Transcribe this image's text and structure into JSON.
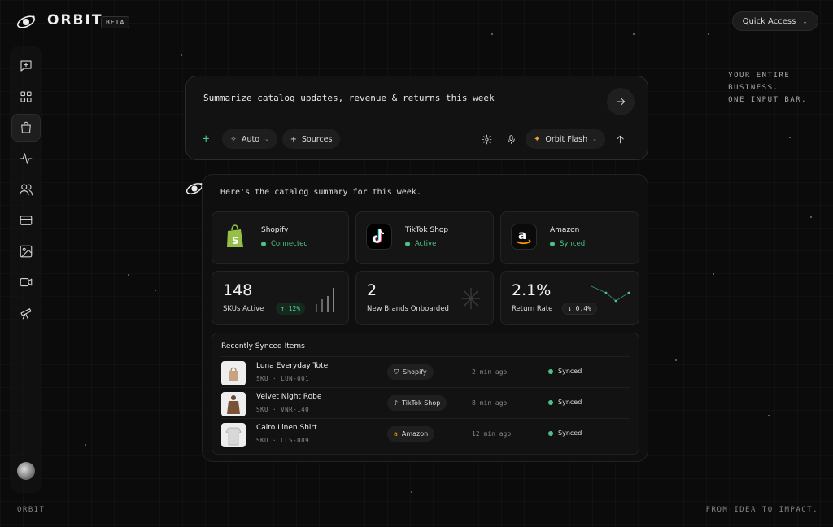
{
  "app": {
    "name": "ORBIT",
    "badge": "BETA",
    "quick_access": "Quick Access"
  },
  "tagline": [
    "YOUR ENTIRE",
    "BUSINESS.",
    "ONE INPUT BAR."
  ],
  "footer": {
    "left": "ORBIT",
    "right": "FROM IDEA TO IMPACT."
  },
  "sidebar": {
    "items": [
      {
        "icon": "new-chat-icon"
      },
      {
        "icon": "grid-icon"
      },
      {
        "icon": "shopping-bag-icon",
        "active": true
      },
      {
        "icon": "activity-icon"
      },
      {
        "icon": "users-icon"
      },
      {
        "icon": "credit-card-icon"
      },
      {
        "icon": "image-icon"
      },
      {
        "icon": "video-icon"
      },
      {
        "icon": "telescope-icon"
      }
    ]
  },
  "prompt": {
    "text": "Summarize catalog updates, revenue & returns this week",
    "mode": "Auto",
    "sources": "Sources",
    "model": "Orbit Flash"
  },
  "response": {
    "intro": "Here's the catalog summary for this week.",
    "stores": [
      {
        "name": "Shopify",
        "status": "Connected"
      },
      {
        "name": "TikTok Shop",
        "status": "Active"
      },
      {
        "name": "Amazon",
        "status": "Synced"
      }
    ],
    "stats": [
      {
        "value": "148",
        "label": "SKUs Active",
        "delta": "↑ 12%"
      },
      {
        "value": "2",
        "label": "New Brands Onboarded"
      },
      {
        "value": "2.1%",
        "label": "Return Rate",
        "delta": "↓ 0.4%"
      }
    ],
    "recent_title": "Recently Synced Items",
    "items": [
      {
        "name": "Luna Everyday Tote",
        "sku": "SKU · LUN-001",
        "source": "Shopify",
        "time": "2 min ago",
        "status": "Synced"
      },
      {
        "name": "Velvet Night Robe",
        "sku": "SKU · VNR-140",
        "source": "TikTok Shop",
        "time": "8 min ago",
        "status": "Synced"
      },
      {
        "name": "Cairo Linen Shirt",
        "sku": "SKU · CLS-089",
        "source": "Amazon",
        "time": "12 min ago",
        "status": "Synced"
      }
    ]
  },
  "colors": {
    "accent_green": "#4cc38a",
    "flash_orange": "#f09a3e",
    "background": "#0b0b0b"
  }
}
